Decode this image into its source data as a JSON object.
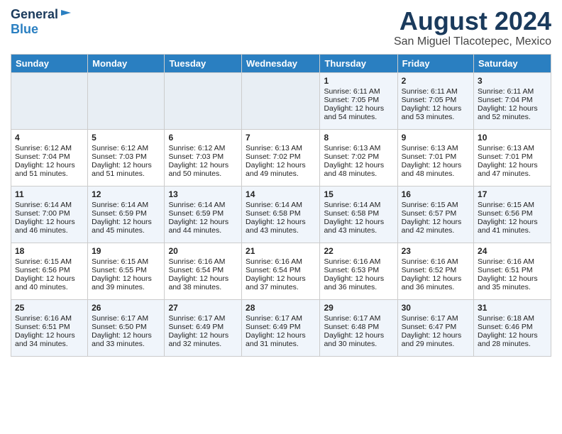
{
  "header": {
    "logo_general": "General",
    "logo_blue": "Blue",
    "month_title": "August 2024",
    "location": "San Miguel Tlacotepec, Mexico"
  },
  "weekdays": [
    "Sunday",
    "Monday",
    "Tuesday",
    "Wednesday",
    "Thursday",
    "Friday",
    "Saturday"
  ],
  "weeks": [
    [
      {
        "day": "",
        "info": ""
      },
      {
        "day": "",
        "info": ""
      },
      {
        "day": "",
        "info": ""
      },
      {
        "day": "",
        "info": ""
      },
      {
        "day": "1",
        "info": "Sunrise: 6:11 AM\nSunset: 7:05 PM\nDaylight: 12 hours\nand 54 minutes."
      },
      {
        "day": "2",
        "info": "Sunrise: 6:11 AM\nSunset: 7:05 PM\nDaylight: 12 hours\nand 53 minutes."
      },
      {
        "day": "3",
        "info": "Sunrise: 6:11 AM\nSunset: 7:04 PM\nDaylight: 12 hours\nand 52 minutes."
      }
    ],
    [
      {
        "day": "4",
        "info": "Sunrise: 6:12 AM\nSunset: 7:04 PM\nDaylight: 12 hours\nand 51 minutes."
      },
      {
        "day": "5",
        "info": "Sunrise: 6:12 AM\nSunset: 7:03 PM\nDaylight: 12 hours\nand 51 minutes."
      },
      {
        "day": "6",
        "info": "Sunrise: 6:12 AM\nSunset: 7:03 PM\nDaylight: 12 hours\nand 50 minutes."
      },
      {
        "day": "7",
        "info": "Sunrise: 6:13 AM\nSunset: 7:02 PM\nDaylight: 12 hours\nand 49 minutes."
      },
      {
        "day": "8",
        "info": "Sunrise: 6:13 AM\nSunset: 7:02 PM\nDaylight: 12 hours\nand 48 minutes."
      },
      {
        "day": "9",
        "info": "Sunrise: 6:13 AM\nSunset: 7:01 PM\nDaylight: 12 hours\nand 48 minutes."
      },
      {
        "day": "10",
        "info": "Sunrise: 6:13 AM\nSunset: 7:01 PM\nDaylight: 12 hours\nand 47 minutes."
      }
    ],
    [
      {
        "day": "11",
        "info": "Sunrise: 6:14 AM\nSunset: 7:00 PM\nDaylight: 12 hours\nand 46 minutes."
      },
      {
        "day": "12",
        "info": "Sunrise: 6:14 AM\nSunset: 6:59 PM\nDaylight: 12 hours\nand 45 minutes."
      },
      {
        "day": "13",
        "info": "Sunrise: 6:14 AM\nSunset: 6:59 PM\nDaylight: 12 hours\nand 44 minutes."
      },
      {
        "day": "14",
        "info": "Sunrise: 6:14 AM\nSunset: 6:58 PM\nDaylight: 12 hours\nand 43 minutes."
      },
      {
        "day": "15",
        "info": "Sunrise: 6:14 AM\nSunset: 6:58 PM\nDaylight: 12 hours\nand 43 minutes."
      },
      {
        "day": "16",
        "info": "Sunrise: 6:15 AM\nSunset: 6:57 PM\nDaylight: 12 hours\nand 42 minutes."
      },
      {
        "day": "17",
        "info": "Sunrise: 6:15 AM\nSunset: 6:56 PM\nDaylight: 12 hours\nand 41 minutes."
      }
    ],
    [
      {
        "day": "18",
        "info": "Sunrise: 6:15 AM\nSunset: 6:56 PM\nDaylight: 12 hours\nand 40 minutes."
      },
      {
        "day": "19",
        "info": "Sunrise: 6:15 AM\nSunset: 6:55 PM\nDaylight: 12 hours\nand 39 minutes."
      },
      {
        "day": "20",
        "info": "Sunrise: 6:16 AM\nSunset: 6:54 PM\nDaylight: 12 hours\nand 38 minutes."
      },
      {
        "day": "21",
        "info": "Sunrise: 6:16 AM\nSunset: 6:54 PM\nDaylight: 12 hours\nand 37 minutes."
      },
      {
        "day": "22",
        "info": "Sunrise: 6:16 AM\nSunset: 6:53 PM\nDaylight: 12 hours\nand 36 minutes."
      },
      {
        "day": "23",
        "info": "Sunrise: 6:16 AM\nSunset: 6:52 PM\nDaylight: 12 hours\nand 36 minutes."
      },
      {
        "day": "24",
        "info": "Sunrise: 6:16 AM\nSunset: 6:51 PM\nDaylight: 12 hours\nand 35 minutes."
      }
    ],
    [
      {
        "day": "25",
        "info": "Sunrise: 6:16 AM\nSunset: 6:51 PM\nDaylight: 12 hours\nand 34 minutes."
      },
      {
        "day": "26",
        "info": "Sunrise: 6:17 AM\nSunset: 6:50 PM\nDaylight: 12 hours\nand 33 minutes."
      },
      {
        "day": "27",
        "info": "Sunrise: 6:17 AM\nSunset: 6:49 PM\nDaylight: 12 hours\nand 32 minutes."
      },
      {
        "day": "28",
        "info": "Sunrise: 6:17 AM\nSunset: 6:49 PM\nDaylight: 12 hours\nand 31 minutes."
      },
      {
        "day": "29",
        "info": "Sunrise: 6:17 AM\nSunset: 6:48 PM\nDaylight: 12 hours\nand 30 minutes."
      },
      {
        "day": "30",
        "info": "Sunrise: 6:17 AM\nSunset: 6:47 PM\nDaylight: 12 hours\nand 29 minutes."
      },
      {
        "day": "31",
        "info": "Sunrise: 6:18 AM\nSunset: 6:46 PM\nDaylight: 12 hours\nand 28 minutes."
      }
    ]
  ]
}
